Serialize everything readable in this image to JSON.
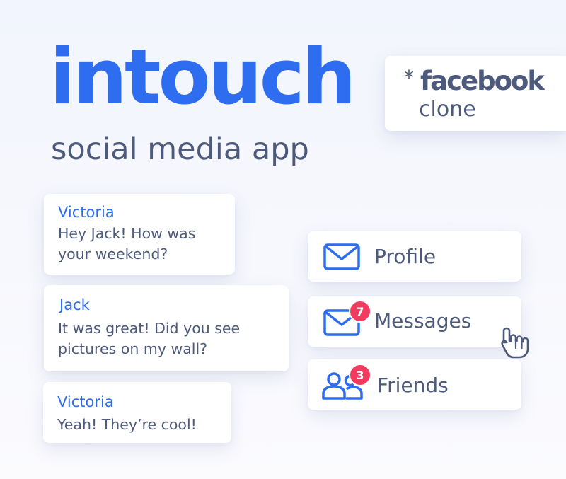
{
  "hero": {
    "title": "intouch",
    "subtitle": "social media app"
  },
  "clone_badge": {
    "asterisk": "*",
    "brand": "facebook",
    "suffix": "clone"
  },
  "messages": [
    {
      "author": "Victoria",
      "lines": [
        "Hey Jack! How was",
        "your weekend?"
      ]
    },
    {
      "author": "Jack",
      "lines": [
        "It was great! Did you see",
        "pictures on my wall?"
      ]
    },
    {
      "author": "Victoria",
      "lines": [
        "Yeah! They’re cool!"
      ]
    }
  ],
  "nav": [
    {
      "label": "Profile",
      "icon": "envelope-icon"
    },
    {
      "label": "Messages",
      "icon": "envelope-icon",
      "badge": "7"
    },
    {
      "label": "Friends",
      "icon": "users-icon",
      "badge": "3"
    }
  ],
  "colors": {
    "brand_blue": "#2f6df0",
    "text_slate": "#4d5a7b",
    "badge_red": "#f23b5e",
    "background": "#f4f6fd"
  },
  "cursor": {
    "icon": "hand-pointer-icon"
  }
}
